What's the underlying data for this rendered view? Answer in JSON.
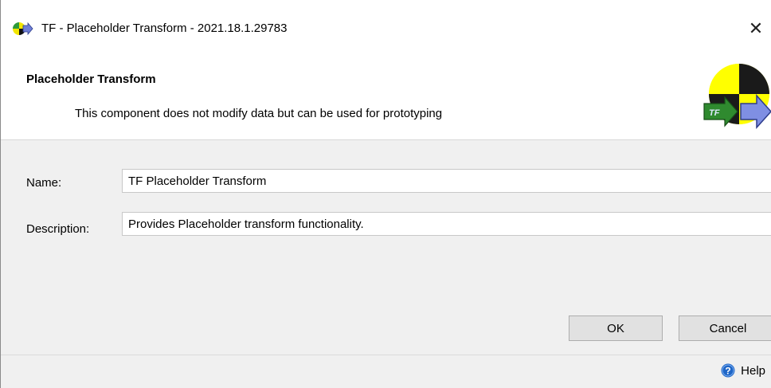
{
  "window": {
    "title": "TF - Placeholder Transform - 2021.18.1.29783",
    "close_glyph": "✕",
    "icon": "app-logo-icon"
  },
  "header": {
    "title": "Placeholder Transform",
    "description": "This component does not modify data but can be used for prototyping",
    "logo_icon": "transform-logo-icon",
    "logo_text": "TF"
  },
  "form": {
    "name_label": "Name:",
    "name_value": "TF Placeholder Transform",
    "description_label": "Description:",
    "description_value": "Provides Placeholder transform functionality."
  },
  "buttons": {
    "ok_label": "OK",
    "cancel_label": "Cancel"
  },
  "footer": {
    "help_label": "Help",
    "help_icon": "help-icon"
  },
  "colors": {
    "logo_yellow": "#ffff00",
    "logo_black": "#1a1a1a",
    "logo_green": "#2f8a2f",
    "logo_blue": "#6f7fd6",
    "help_blue": "#1f66c7"
  }
}
